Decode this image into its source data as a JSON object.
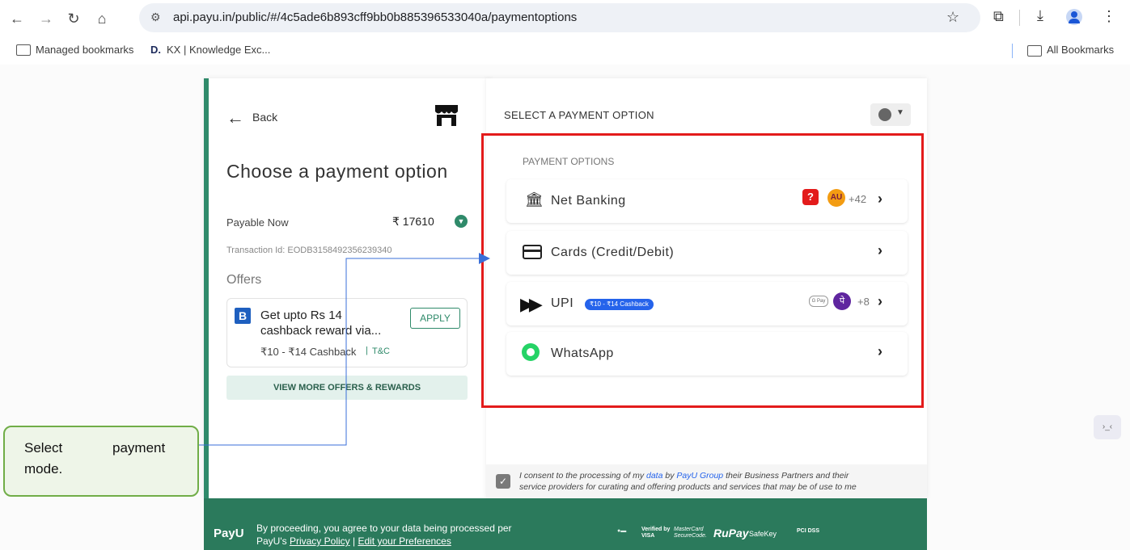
{
  "browser": {
    "url": "api.payu.in/public/#/4c5ade6b893cff9bb0b885396533040a/paymentoptions",
    "bookmarks": [
      "Managed bookmarks",
      "KX | Knowledge Exc..."
    ],
    "bookmark_kx_icon": "D.",
    "all_bookmarks": "All Bookmarks"
  },
  "left": {
    "back_label": "Back",
    "title": "Choose a payment option",
    "payable_label": "Payable Now",
    "payable_amount": "₹ 17610",
    "transaction_id": "Transaction Id: EODB3158492356239340",
    "offers_heading": "Offers",
    "offer": {
      "line1": "Get upto Rs 14",
      "line2": "cashback reward via...",
      "apply_label": "APPLY",
      "cashback": "₹10 - ₹14 Cashback",
      "tnc": "T&C"
    },
    "view_more_label": "VIEW MORE OFFERS & REWARDS"
  },
  "right": {
    "header": "SELECT A PAYMENT OPTION",
    "section_label": "PAYMENT OPTIONS",
    "options": [
      {
        "label": "Net Banking",
        "extra": "+42"
      },
      {
        "label": "Cards (Credit/Debit)",
        "extra": ""
      },
      {
        "label": "UPI",
        "badge": "₹10 - ₹14 Cashback",
        "extra": "+8"
      },
      {
        "label": "WhatsApp",
        "extra": ""
      }
    ],
    "consent_pre": "I consent to the processing of my ",
    "consent_data": "data",
    "consent_mid": " by ",
    "consent_payu": "PayU Group",
    "consent_post1": " their Business Partners and their",
    "consent_line2": "service providers for curating and offering products and services that may be of use to me"
  },
  "footer": {
    "logo": "PayU",
    "line1": "By proceeding, you agree to your data being processed per",
    "line2_pre": "PayU's ",
    "privacy": "Privacy Policy",
    "sep": " | ",
    "edit": "Edit your Preferences",
    "badges": [
      "Verified by VISA",
      "MasterCard SecureCode.",
      "RuPay",
      "SafeKey",
      "PCI DSS"
    ]
  },
  "callout": {
    "text_line1_a": "Select",
    "text_line1_b": "payment",
    "text_line2": "mode."
  },
  "colors": {
    "accent": "#2f8a6a",
    "highlight": "#e31b1b",
    "callout_border": "#70ad47",
    "callout_bg": "#eef5e8",
    "arrow": "#3a6fd8"
  }
}
